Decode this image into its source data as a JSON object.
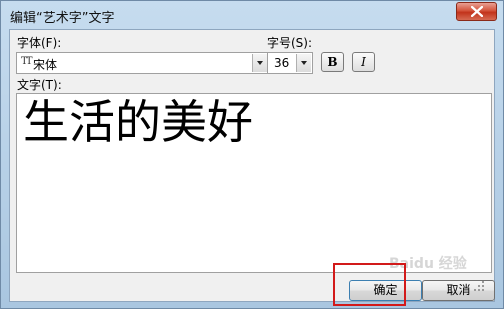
{
  "window": {
    "title": "编辑“艺术字”文字"
  },
  "font": {
    "label": "字体(F):",
    "value": "宋体",
    "icon": "truetype-font-icon"
  },
  "size": {
    "label": "字号(S):",
    "value": "36"
  },
  "style_buttons": {
    "bold_label": "B",
    "italic_label": "I"
  },
  "text": {
    "label": "文字(T):",
    "value": "生活的美好"
  },
  "buttons": {
    "ok_label": "确定",
    "cancel_label": "取消"
  },
  "watermark": {
    "text": "Baidu 经验"
  },
  "colors": {
    "highlight": "#d21a1a",
    "titlebar": "#b5cfe6",
    "close_button": "#c2331b"
  }
}
